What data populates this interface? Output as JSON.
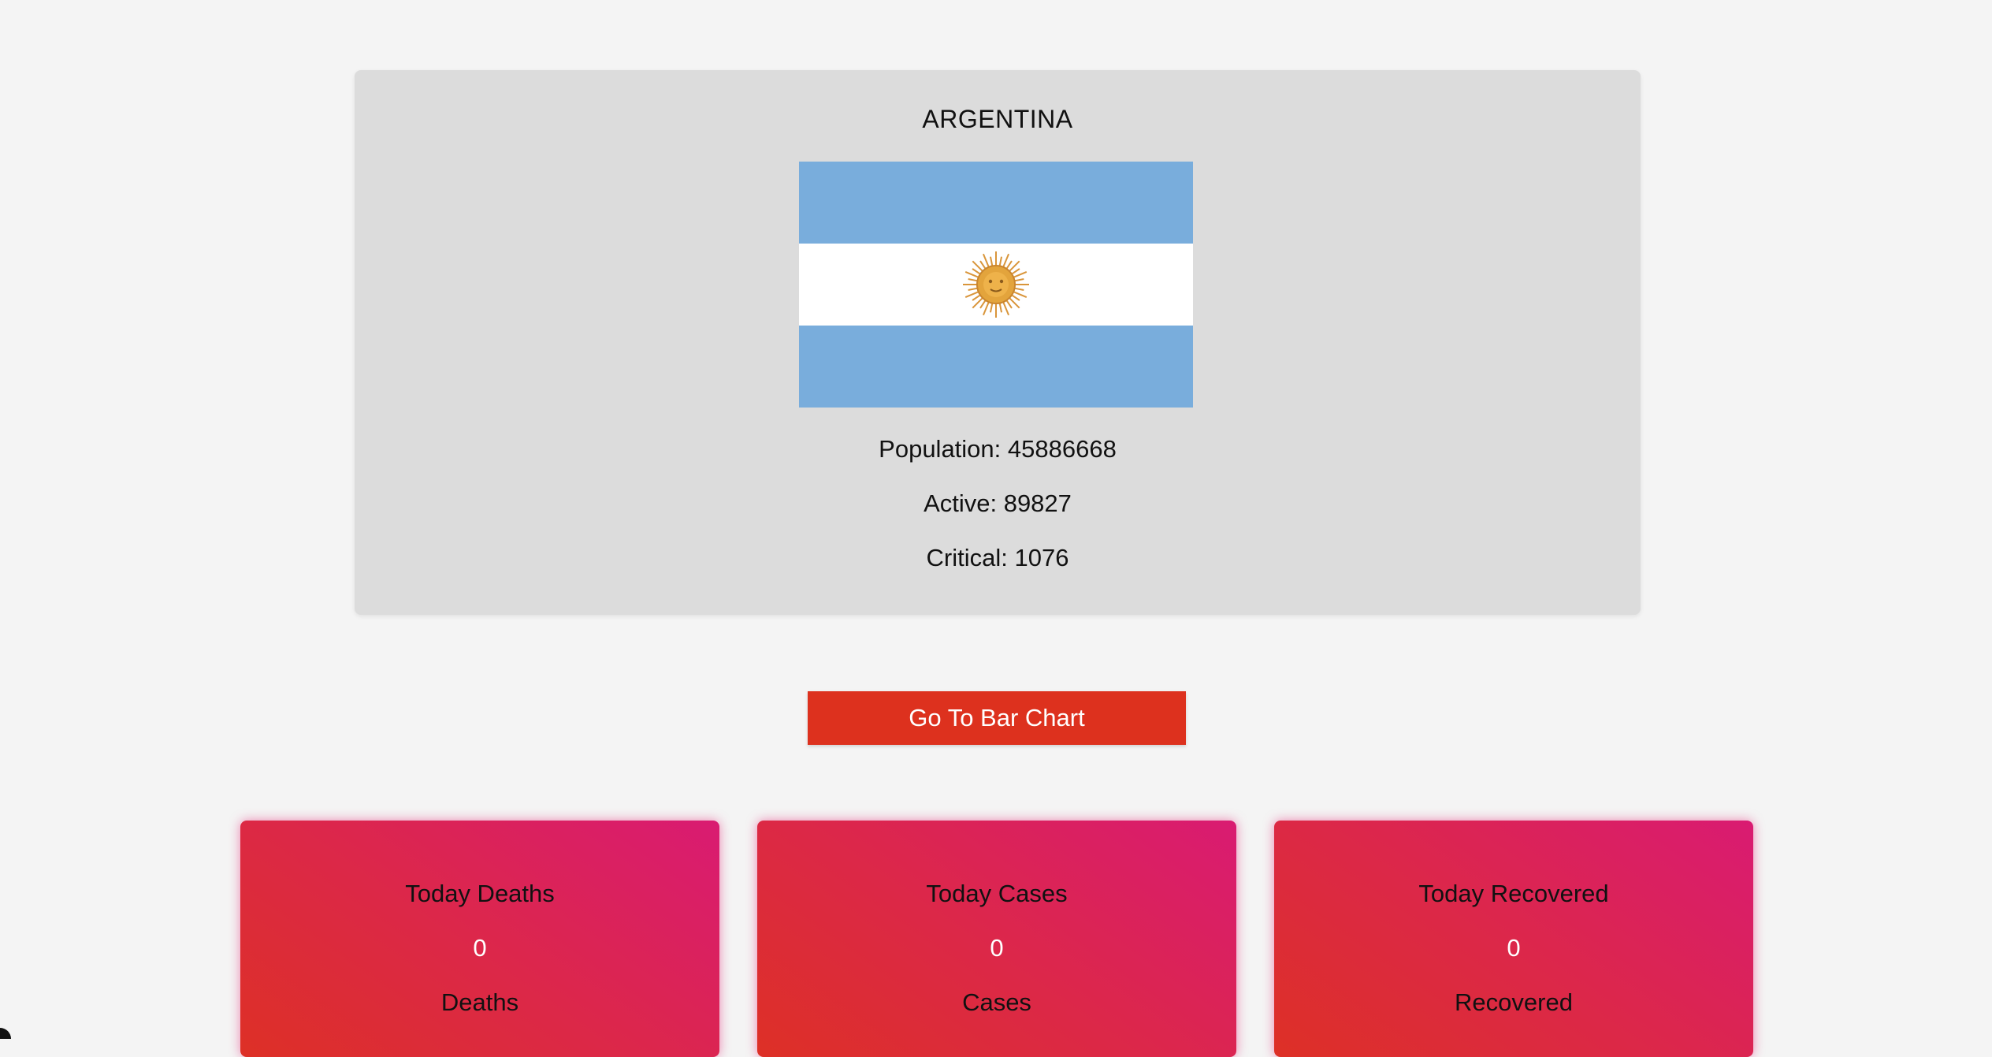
{
  "country": {
    "name": "ARGENTINA",
    "flag_icon": "argentina-flag-icon",
    "population_text": "Population: 45886668",
    "active_text": "Active: 89827",
    "critical_text": "Critical: 1076"
  },
  "actions": {
    "bar_chart_label": "Go To Bar Chart"
  },
  "tiles": [
    {
      "title": "Today Deaths",
      "value": "0",
      "unit": "Deaths"
    },
    {
      "title": "Today Cases",
      "value": "0",
      "unit": "Cases"
    },
    {
      "title": "Today Recovered",
      "value": "0",
      "unit": "Recovered"
    }
  ],
  "colors": {
    "page_background": "#f4f4f4",
    "card_background": "#dcdcdc",
    "button_red": "#dd311e",
    "tile_gradient_start": "#dd3026",
    "tile_gradient_end": "#d91b72",
    "flag_blue": "#79addc",
    "flag_white": "#ffffff",
    "sun_gold": "#e3a43c"
  }
}
